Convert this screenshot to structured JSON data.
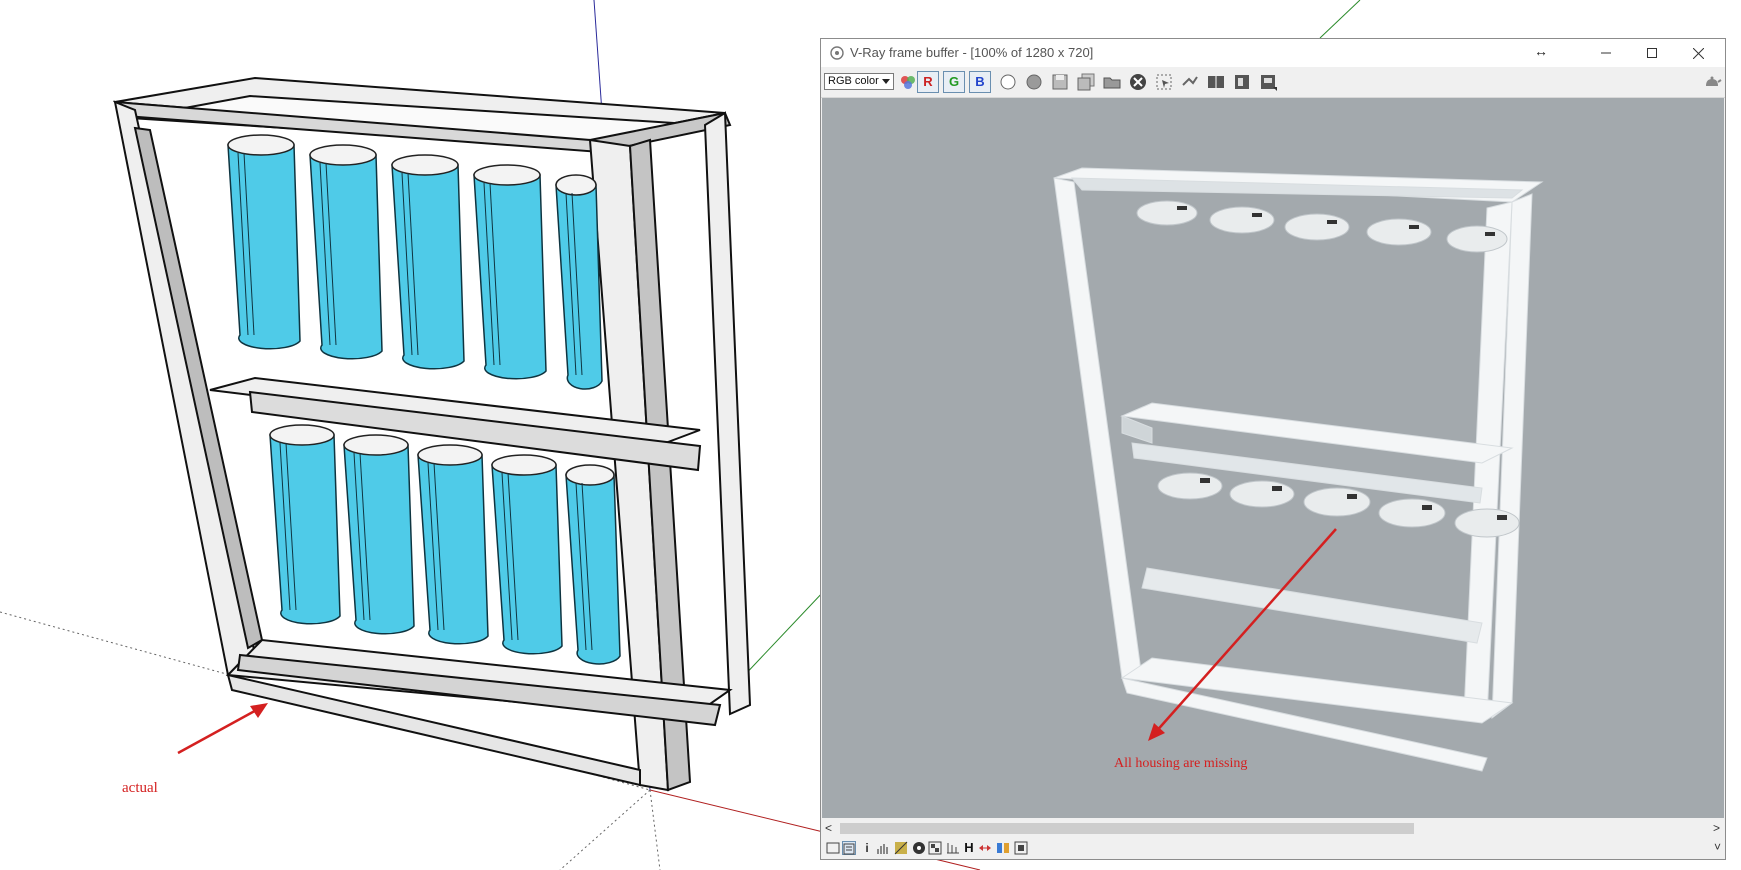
{
  "annotations": {
    "actual_label": "actual",
    "missing_label": "All housing are missing"
  },
  "vray_window": {
    "title": "V-Ray frame buffer - [100% of 1280 x 720]",
    "channel_select_value": "RGB color",
    "channel_buttons": [
      "R",
      "G",
      "B"
    ],
    "toolbar_icons": [
      "color-correction-icon",
      "track-mouse-icon",
      "sphere-icon",
      "save-icon",
      "save-all-icon",
      "open-icon",
      "clear-icon",
      "region-render-icon",
      "link-to-viewport-icon",
      "compare-ab-icon",
      "history-icon",
      "lens-effects-icon",
      "render-teapot-icon"
    ],
    "bottom_icons": [
      "display-icon",
      "stamp-icon",
      "info-icon",
      "histogram-icon",
      "lut-icon",
      "srgb-icon",
      "exposure-icon",
      "levels-icon",
      "hue-icon",
      "curves-icon",
      "pixel-icon",
      "settings-icon"
    ],
    "bottom_h_label": "H",
    "window_controls": [
      "minimize",
      "maximize",
      "close"
    ],
    "scroll_left": "<",
    "scroll_right": ">",
    "scroll_down": "˅"
  },
  "colors": {
    "annotation": "#d42020",
    "cylinder": "#4fcbe8",
    "frame": "#efefef",
    "render_background": "#a3a9ad"
  }
}
